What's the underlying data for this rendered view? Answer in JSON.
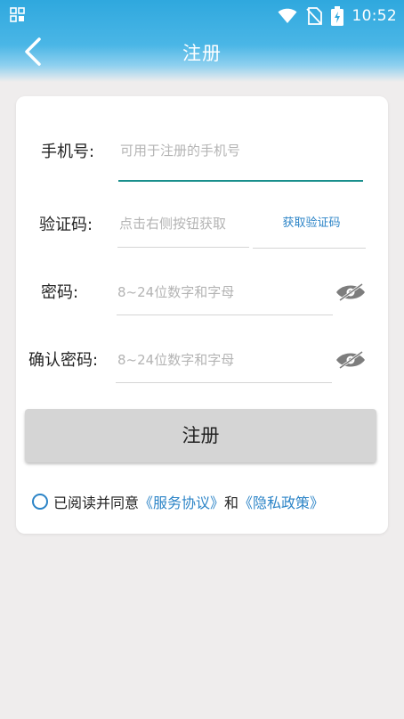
{
  "status_bar": {
    "time": "10:52",
    "icons": [
      "apps-icon",
      "wifi-icon",
      "no-sim-icon",
      "battery-icon"
    ]
  },
  "header": {
    "title": "注册",
    "back_icon": "chevron-left-icon"
  },
  "form": {
    "phone": {
      "label": "手机号:",
      "placeholder": "可用于注册的手机号",
      "value": ""
    },
    "code": {
      "label": "验证码:",
      "placeholder": "点击右侧按钮获取",
      "value": "",
      "button_label": "获取验证码"
    },
    "password": {
      "label": "密码:",
      "placeholder": "8~24位数字和字母",
      "value": "",
      "toggle_icon": "eye-off-icon"
    },
    "confirm_password": {
      "label": "确认密码:",
      "placeholder": "8~24位数字和字母",
      "value": "",
      "toggle_icon": "eye-off-icon"
    },
    "submit_label": "注册"
  },
  "agreement": {
    "prefix": "已阅读并同意",
    "service_link": "《服务协议》",
    "conjunction": "和",
    "privacy_link": "《隐私政策》",
    "checked": false
  },
  "colors": {
    "header_blue": "#2fa8de",
    "accent_teal": "#1a8f8d",
    "link_blue": "#2c84c7",
    "button_gray": "#d5d5d5",
    "background": "#efeded"
  }
}
